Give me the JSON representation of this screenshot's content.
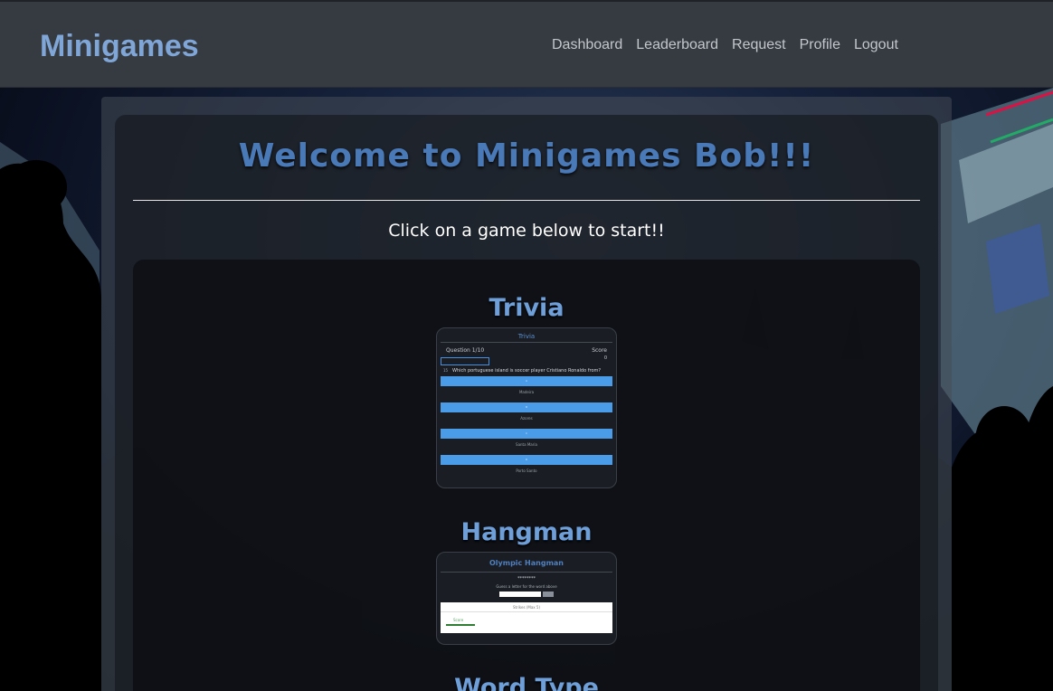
{
  "navbar": {
    "brand": "Minigames",
    "links": [
      "Dashboard",
      "Leaderboard",
      "Request",
      "Profile",
      "Logout"
    ]
  },
  "main": {
    "welcome": "Welcome to Minigames Bob!!!",
    "subtitle": "Click on a game below to start!!",
    "games": [
      {
        "title": "Trivia",
        "preview": {
          "header": "Trivia",
          "question_counter": "Question 1/10",
          "score_label": "Score",
          "score_value": "0",
          "timer": "15",
          "question": "Which portuguese island is soccer player Cristiano Ronaldo from?",
          "answers": [
            {
              "key": "A",
              "text": "Madeira"
            },
            {
              "key": "B",
              "text": "Azores"
            },
            {
              "key": "C",
              "text": "Santa Maria"
            },
            {
              "key": "D",
              "text": "Porto Santo"
            }
          ]
        }
      },
      {
        "title": "Hangman",
        "preview": {
          "header": "Olympic Hangman",
          "masked_word": "********",
          "hint": "Guess a letter for the word above",
          "box_title": "Strikes (Max 5)",
          "score_label": "Score"
        }
      },
      {
        "title": "Word Type"
      }
    ]
  },
  "colors": {
    "brand": "#7fa6d6",
    "welcome": "#4a79b8",
    "game_title": "#6e9fd8",
    "answer_bar": "#4a9be8"
  }
}
